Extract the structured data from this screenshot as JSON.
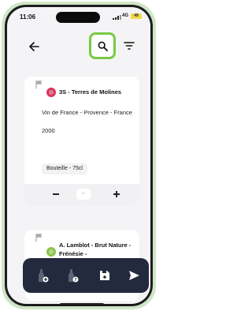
{
  "status_bar": {
    "time": "11:06",
    "network": "4G",
    "battery": "49"
  },
  "header": {
    "back_icon": "arrow-left-icon",
    "search_icon": "search-icon",
    "filter_icon": "filter-icon",
    "highlight_color": "#7ac943"
  },
  "wines": [
    {
      "icon": "red-wine-icon",
      "color": "#d9365b",
      "name": "3S - Terres de Molines",
      "region": "Vin de France - Provence - France",
      "year": "2000",
      "format": "Bouteille - 75cl",
      "quantity": "--"
    },
    {
      "icon": "white-wine-icon",
      "color": "#8bc34a",
      "name": "A. Lamblot - Brut Nature - Frénésie -"
    }
  ],
  "action_bar": {
    "background": "#232a3d",
    "buttons": [
      "add-bottle-icon",
      "bottle-question-icon",
      "save-icon",
      "send-icon"
    ]
  }
}
